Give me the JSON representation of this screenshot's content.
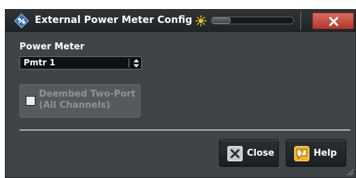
{
  "window": {
    "title": "External Power Meter Config",
    "icons": {
      "app": "rohde-schwarz-diamond-icon",
      "brightness": "sun-icon",
      "close": "close-x-icon"
    },
    "colors": {
      "window_bg": "#3f4449",
      "titlebar_bg": "#23272b",
      "close_button": "#c44a3c"
    }
  },
  "power_meter": {
    "label": "Power Meter",
    "selected": "Pmtr 1"
  },
  "deembed": {
    "label_line1": "Deembed Two-Port",
    "label_line2": "(All Channels)",
    "checked": false,
    "enabled": false
  },
  "buttons": {
    "close_label": "Close",
    "help_label": "Help"
  }
}
